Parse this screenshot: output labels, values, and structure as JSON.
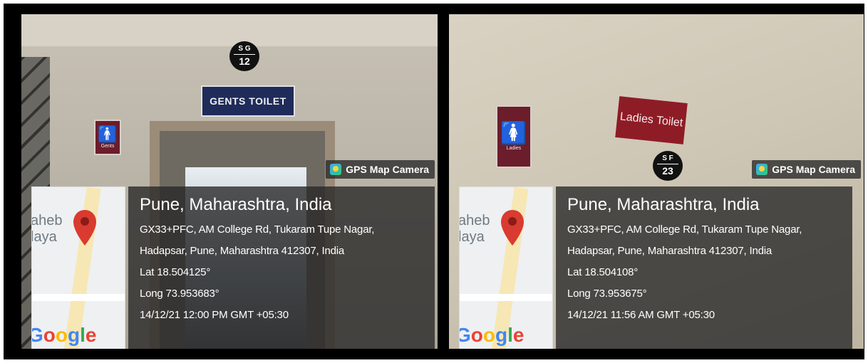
{
  "photos": [
    {
      "side": "left",
      "room_sign": "GENTS TOILET",
      "door_number_top": "S G",
      "door_number_bottom": "12",
      "pictogram_caption": "Gents",
      "gps_app_label": "GPS Map Camera",
      "map_place_text": "aheb\nlaya",
      "map_logo": "Google",
      "city": "Pune, Maharashtra, India",
      "address_line1": "GX33+PFC, AM College Rd, Tukaram Tupe Nagar,",
      "address_line2": "Hadapsar, Pune, Maharashtra 412307, India",
      "lat": "Lat 18.504125°",
      "long": "Long 73.953683°",
      "timestamp": "14/12/21 12:00 PM GMT +05:30"
    },
    {
      "side": "right",
      "room_sign": "Ladies Toilet",
      "door_number_top": "S F",
      "door_number_bottom": "23",
      "pictogram_caption": "Ladies",
      "gps_app_label": "GPS Map Camera",
      "map_place_text": "aheb\nlaya",
      "map_logo": "Google",
      "city": "Pune, Maharashtra, India",
      "address_line1": "GX33+PFC, AM College Rd, Tukaram Tupe Nagar,",
      "address_line2": "Hadapsar, Pune, Maharashtra 412307, India",
      "lat": "Lat 18.504108°",
      "long": "Long 73.953675°",
      "timestamp": "14/12/21 11:56 AM GMT +05:30"
    }
  ],
  "colors": {
    "gents_sign": "#1f2b5a",
    "ladies_sign": "#8e1c26",
    "overlay": "#262626",
    "map_pin": "#d93b30"
  }
}
